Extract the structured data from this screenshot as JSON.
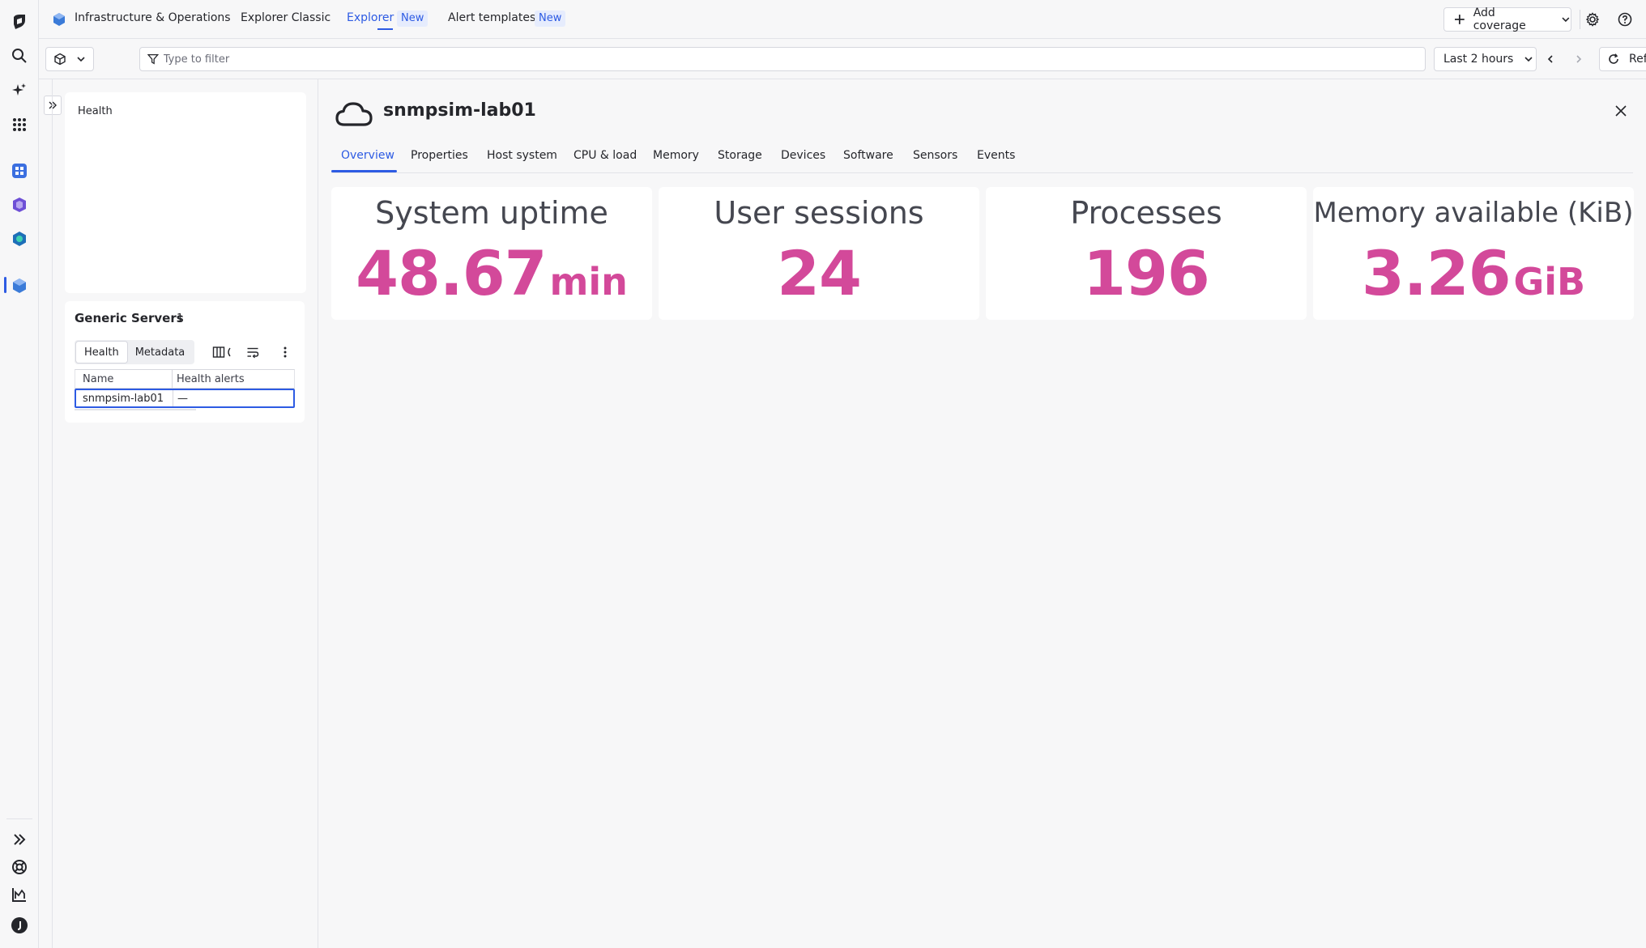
{
  "app": {
    "name": "Infrastructure & Operations",
    "nav_tabs": [
      {
        "label": "Explorer Classic"
      },
      {
        "label": "Explorer",
        "badge": "New"
      },
      {
        "label": "Alert templates",
        "badge": "New"
      }
    ],
    "add_coverage_label": "Add coverage"
  },
  "filter": {
    "placeholder": "Type to filter",
    "timeframe": "Last 2 hours",
    "refresh_label": "Refresh"
  },
  "left_panel": {
    "health_title": "Health",
    "servers": {
      "title": "Generic Servers",
      "count": "1",
      "segments": [
        "Health",
        "Metadata"
      ],
      "columns": [
        "Name",
        "Health alerts"
      ],
      "rows": [
        {
          "name": "snmpsim-lab01",
          "health_alerts": "—"
        }
      ]
    }
  },
  "detail": {
    "title": "snmpsim-lab01",
    "entity_icon": "cloud-icon",
    "tabs": [
      "Overview",
      "Properties",
      "Host system",
      "CPU & load",
      "Memory",
      "Storage",
      "Devices",
      "Software",
      "Sensors",
      "Events"
    ],
    "active_tab": "Overview",
    "tiles": [
      {
        "label": "System uptime",
        "value": "48.67",
        "unit": "min"
      },
      {
        "label": "User sessions",
        "value": "24",
        "unit": ""
      },
      {
        "label": "Processes",
        "value": "196",
        "unit": ""
      },
      {
        "label": "Memory available (KiB)",
        "value": "3.26",
        "unit": "GiB"
      }
    ]
  },
  "colors": {
    "accent": "#2d5be3",
    "metric": "#d3499a"
  }
}
